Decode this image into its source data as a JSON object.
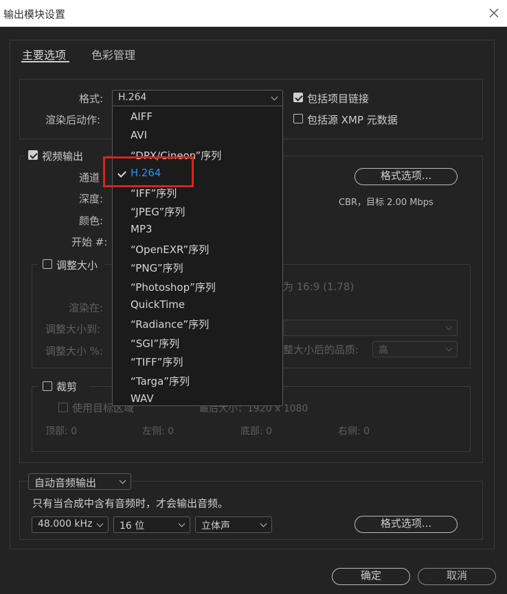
{
  "window": {
    "title": "输出模块设置"
  },
  "tabs": [
    {
      "label": "主要选项"
    },
    {
      "label": "色彩管理"
    }
  ],
  "format": {
    "label": "格式:",
    "value": "H.264",
    "include_project_link": "包括项目链接",
    "include_xmp": "包括源 XMP 元数据",
    "post_render_label": "渲染后动作:"
  },
  "dropdown": {
    "options": [
      "AIFF",
      "AVI",
      "“DPX/Cineon”序列",
      "H.264",
      "“IFF”序列",
      "“JPEG”序列",
      "MP3",
      "“OpenEXR”序列",
      "“PNG”序列",
      "“Photoshop”序列",
      "QuickTime",
      "“Radiance”序列",
      "“SGI”序列",
      "“TIFF”序列",
      "“Targa”序列",
      "WAV"
    ],
    "selected_index": 3
  },
  "video": {
    "label": "视频输出",
    "channel_label": "通道",
    "depth_label": "深度:",
    "color_label": "颜色:",
    "start_label": "开始 #:",
    "format_options_button": "格式选项...",
    "bitrate_info": "CBR，目标 2.00 Mbps"
  },
  "resize": {
    "label": "调整大小",
    "render_at": "渲染在:",
    "resize_to": "调整大小到:",
    "resize_pct": "调整大小 %:",
    "aspect_fragment": "为 16:9 (1.78)",
    "quality_label": "整大小后的品质:",
    "quality_value": "高"
  },
  "crop": {
    "label": "裁剪",
    "use_roi": "使用目标区域",
    "final_size": "最后大小：1920 x 1080",
    "top": "顶部:  0",
    "left": "左侧:  0",
    "bottom": "底部:  0",
    "right": "右侧:  0"
  },
  "audio": {
    "mode": "自动音频输出",
    "note": "只有当合成中含有音频时，才会输出音频。",
    "sample_rate": "48.000 kHz",
    "bit_depth": "16 位",
    "channels": "立体声",
    "format_options_button": "格式选项..."
  },
  "footer": {
    "ok": "确定",
    "cancel": "取消"
  },
  "colors": {
    "highlight": "#e02020",
    "selected_text": "#2f8ef5"
  }
}
